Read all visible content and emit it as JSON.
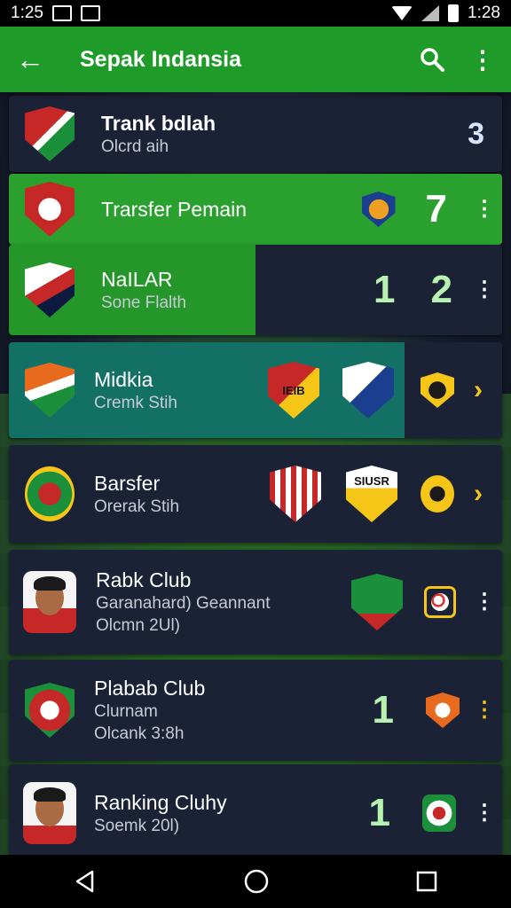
{
  "status_bar": {
    "time_left": "1:25",
    "time_right": "1:28"
  },
  "app_bar": {
    "title": "Sepak Indansia",
    "back_icon": "arrow-left-icon",
    "search_icon": "search-icon",
    "menu_icon": "more-vert-icon"
  },
  "rows": [
    {
      "name": "Trank bdlah",
      "sub": "Olcrd aih",
      "value": "3"
    },
    {
      "name": "Trarsfer Pemain",
      "value": "7"
    },
    {
      "name": "NaILAR",
      "sub": "Sone Flalth",
      "value_a": "1",
      "value_b": "2"
    },
    {
      "name": "Midkia",
      "sub": "Cremk Stih"
    },
    {
      "name": "Barsfer",
      "sub": "Orerak Stih"
    },
    {
      "name": "Rabk Club",
      "sub": "Garanahard) Geannant",
      "sub2": "Olcmn 2Ul)"
    },
    {
      "name": "Plabab Club",
      "sub": "Clurnam",
      "sub2": "Olcank 3:8h",
      "value": "1"
    },
    {
      "name": "Ranking Cluhy",
      "sub": "Soemk 20l)",
      "value": "1"
    }
  ],
  "badges": {
    "row4_crest_1": "IEIB",
    "row5_crest_2": "SIUSR"
  },
  "colors": {
    "accent": "#1f9b2a",
    "card": "#1c2236",
    "highlight_teal": "#137064",
    "chevron": "#f5c518"
  }
}
